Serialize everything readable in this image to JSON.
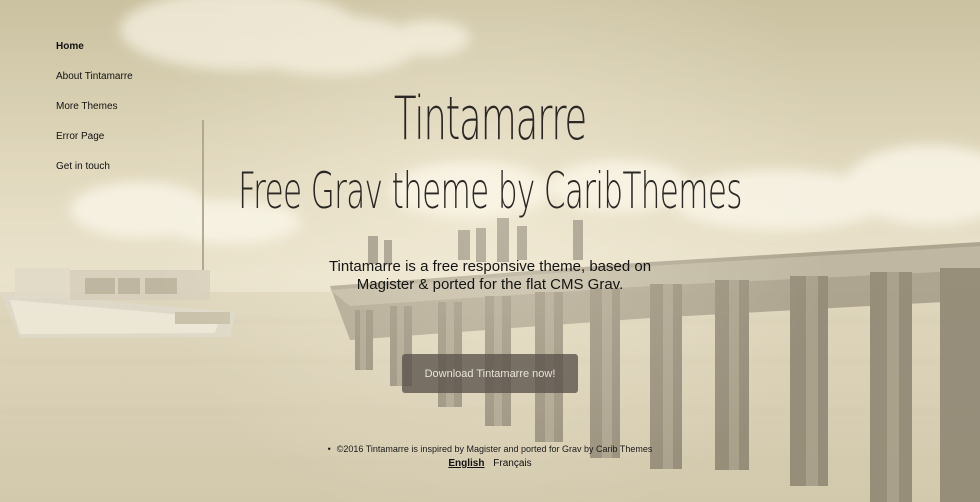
{
  "nav": {
    "items": [
      {
        "label": "Home",
        "active": true
      },
      {
        "label": "About Tintamarre",
        "active": false
      },
      {
        "label": "More Themes",
        "active": false
      },
      {
        "label": "Error Page",
        "active": false
      },
      {
        "label": "Get in touch",
        "active": false
      }
    ]
  },
  "hero": {
    "title": "Tintamarre",
    "subtitle": "Free Grav theme by CaribThemes",
    "description_line1": "Tintamarre is a free responsive theme, based on",
    "description_line2": "Magister & ported for the flat CMS Grav.",
    "cta_label": "Download Tintamarre now!"
  },
  "footer": {
    "text": "©2016 Tintamarre is inspired by Magister and ported for Grav by Carib Themes",
    "languages": [
      {
        "label": "English",
        "active": true
      },
      {
        "label": "Français",
        "active": false
      }
    ]
  }
}
